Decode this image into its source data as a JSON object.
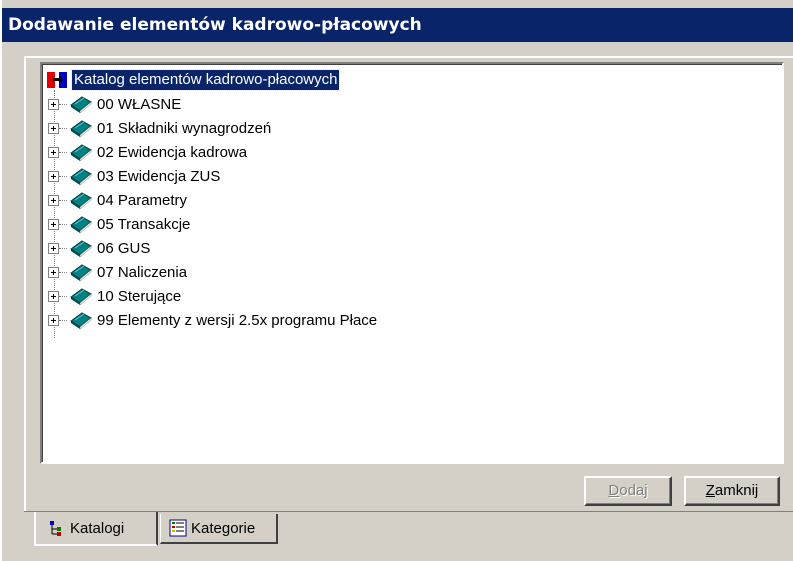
{
  "window": {
    "title": "Dodawanie elementów kadrowo-płacowych"
  },
  "tree": {
    "root_label": "Katalog elementów kadrowo-płacowych",
    "nodes": [
      {
        "label": "00 WŁASNE"
      },
      {
        "label": "01 Składniki wynagrodzeń"
      },
      {
        "label": "02 Ewidencja kadrowa"
      },
      {
        "label": "03 Ewidencja ZUS"
      },
      {
        "label": "04 Parametry"
      },
      {
        "label": "05 Transakcje"
      },
      {
        "label": "06 GUS"
      },
      {
        "label": "07 Naliczenia"
      },
      {
        "label": "10 Sterujące"
      },
      {
        "label": "99 Elementy z wersji 2.5x programu Płace"
      }
    ]
  },
  "buttons": {
    "dodaj": {
      "label_ul": "D",
      "label_rest": "odaj",
      "enabled": false
    },
    "zamknij": {
      "label_ul": "Z",
      "label_rest": "amknij",
      "enabled": true
    }
  },
  "tabs": {
    "katalogi": "Katalogi",
    "kategorie": "Kategorie",
    "active": "Katalogi"
  },
  "icons": {
    "root": "catalog-root-icon",
    "node": "book-icon",
    "tab_katalogi": "tree-icon",
    "tab_kategorie": "list-icon"
  },
  "colors": {
    "title_bar": "#0a246a",
    "selection": "#0a246a",
    "face": "#d4d0c8",
    "book": "#008080"
  }
}
